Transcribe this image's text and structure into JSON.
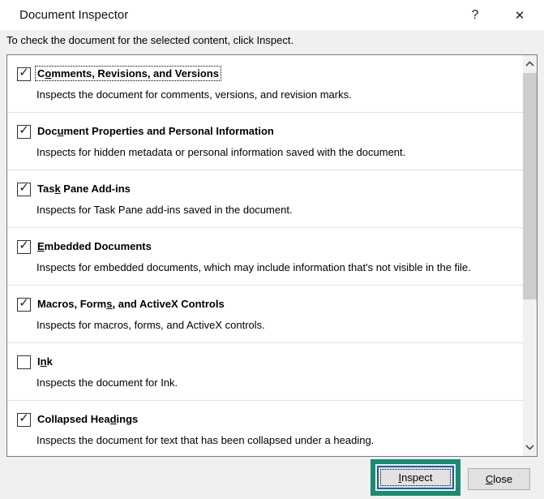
{
  "window": {
    "title": "Document Inspector",
    "help_icon": "?",
    "close_icon": "✕"
  },
  "instruction": "To check the document for the selected content, click Inspect.",
  "list": {
    "items": [
      {
        "label_pre": "C",
        "label_accel": "o",
        "label_post": "mments, Revisions, and Versions",
        "checked": true,
        "check_glyph": "✓",
        "description": "Inspects the document for comments, versions, and revision marks."
      },
      {
        "label_pre": "Doc",
        "label_accel": "u",
        "label_post": "ment Properties and Personal Information",
        "checked": true,
        "check_glyph": "✓",
        "description": "Inspects for hidden metadata or personal information saved with the document."
      },
      {
        "label_pre": "Tas",
        "label_accel": "k",
        "label_post": " Pane Add-ins",
        "checked": true,
        "check_glyph": "✓",
        "description": "Inspects for Task Pane add-ins saved in the document."
      },
      {
        "label_pre": "",
        "label_accel": "E",
        "label_post": "mbedded Documents",
        "checked": true,
        "check_glyph": "✓",
        "description": "Inspects for embedded documents, which may include information that's not visible in the file."
      },
      {
        "label_pre": "Macros, Form",
        "label_accel": "s",
        "label_post": ", and ActiveX Controls",
        "checked": true,
        "check_glyph": "✓",
        "description": "Inspects for macros, forms, and ActiveX controls."
      },
      {
        "label_pre": "I",
        "label_accel": "n",
        "label_post": "k",
        "checked": false,
        "check_glyph": "",
        "description": "Inspects the document for Ink."
      },
      {
        "label_pre": "Collapsed Hea",
        "label_accel": "d",
        "label_post": "ings",
        "checked": true,
        "check_glyph": "✓",
        "description": "Inspects the document for text that has been collapsed under a heading."
      }
    ]
  },
  "footer": {
    "inspect": {
      "pre": "",
      "accel": "I",
      "post": "nspect"
    },
    "close": {
      "pre": "",
      "accel": "C",
      "post": "lose"
    }
  },
  "colors": {
    "annotation_highlight": "#1c8a71",
    "default_button_border": "#0063b1",
    "titlebar_bg": "#ffffff",
    "dialog_bg": "#f0f0f0",
    "scrollbar_thumb": "#cdcdcd",
    "scrollbar_track": "#f1f1f1"
  }
}
